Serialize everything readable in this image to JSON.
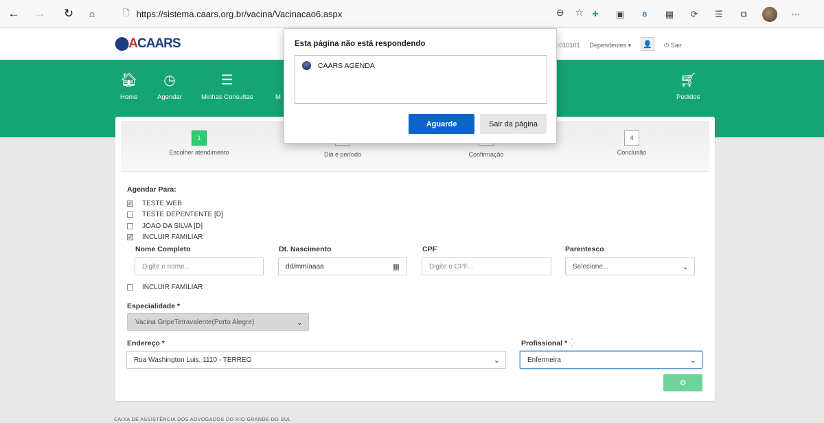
{
  "browser": {
    "url": "https://sistema.caars.org.br/vacina/Vacinacao6.aspx",
    "back_icon": "arrow-left-icon",
    "forward_icon": "arrow-right-icon",
    "refresh_icon": "refresh-icon",
    "home_icon": "home-icon"
  },
  "header": {
    "logo_text": "CAARS",
    "user_code": "B:010101",
    "dependents_label": "Dependentes ▾",
    "logout_label": "⏻ Sair"
  },
  "nav": {
    "items": [
      {
        "label": "Home",
        "icon": "home-icon"
      },
      {
        "label": "Agendar",
        "icon": "clock-icon"
      },
      {
        "label": "Minhas Consultas",
        "icon": "list-icon"
      },
      {
        "label": "M",
        "icon": ""
      },
      {
        "label": "Pedidos",
        "icon": "cart-icon"
      }
    ]
  },
  "wizard": {
    "steps": [
      {
        "num": "1",
        "label": "Escolher atendimento"
      },
      {
        "num": "",
        "label": "Dia e período"
      },
      {
        "num": "",
        "label": "Confirmação"
      },
      {
        "num": "4",
        "label": "Conclusão"
      }
    ]
  },
  "form": {
    "schedule_for_label": "Agendar Para:",
    "people": [
      {
        "label": "TESTE WEB",
        "checked": true
      },
      {
        "label": "TESTE DEPENTENTE [D]",
        "checked": false
      },
      {
        "label": "JOAO DA SILVA [D]",
        "checked": false
      },
      {
        "label": "INCLUIR FAMILIAR",
        "checked": true
      }
    ],
    "full_name_label": "Nome Completo",
    "full_name_placeholder": "Digite o nome...",
    "birth_label": "Dt. Nascimento",
    "birth_placeholder": "dd/mm/aaaa",
    "cpf_label": "CPF",
    "cpf_placeholder": "Digite o CPF...",
    "relation_label": "Parentesco",
    "relation_value": "Selecione...",
    "include_family_label": "INCLUIR FAMILIAR",
    "specialty_label": "Especialidade *",
    "specialty_value": "Vacina GripeTetravalente(Porto Alegre)",
    "address_label": "Endereço *",
    "address_value": "Rua Washington Luis, 1110 - TÉRREO",
    "professional_label": "Profissional *",
    "professional_value": "Enfermeira",
    "action_icon": "gear-icon"
  },
  "footer": {
    "text": "CAIXA DE ASSISTÊNCIA DOS ADVOGADOS DO RIO GRANDE DO SUL"
  },
  "dialog": {
    "title": "Esta página não está respondendo",
    "item_label": "CAARS AGENDA",
    "wait_label": "Aguarde",
    "leave_label": "Sair da página"
  }
}
